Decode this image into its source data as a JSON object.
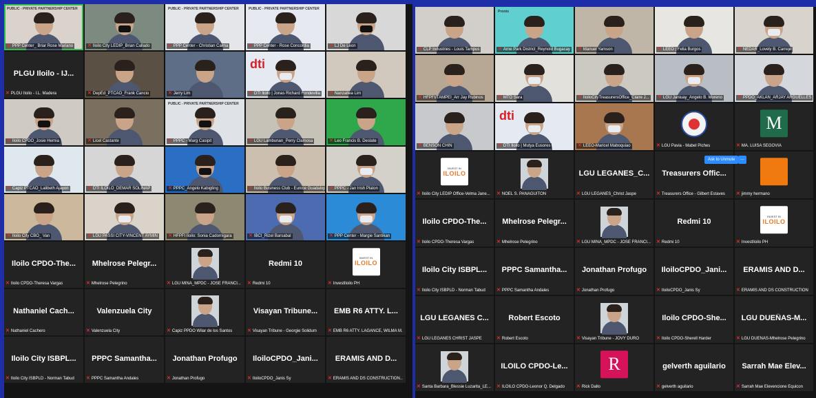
{
  "left_panel": {
    "tiles": [
      {
        "name": "PPP Center_ Briar Rose Mariano",
        "kind": "person",
        "bg": "#d9d3cc",
        "active": true,
        "logo": "PUBLIC - PRIVATE PARTNERSHIP CENTER"
      },
      {
        "name": "Iloilo City LEDIP_Brian Callado",
        "kind": "person",
        "bg": "#7d8a80",
        "mask": "dark"
      },
      {
        "name": "PPP Center - Christian Calma",
        "kind": "person",
        "bg": "#e4e6ea",
        "logo": "PUBLIC - PRIVATE PARTNERSHIP CENTER"
      },
      {
        "name": "PPP Center - Rose Concordia",
        "kind": "person",
        "bg": "#e6eaf0",
        "logo": "PUBLIC - PRIVATE PARTNERSHIP CENTER"
      },
      {
        "name": "LJ De Leon",
        "kind": "person",
        "bg": "#d8d8d8",
        "mask": "dark"
      },
      {
        "name": "PLGU Iloilo - IJ...",
        "label": "PLGU Iloilo - I.L. Madera",
        "kind": "text"
      },
      {
        "name": "DepEd_PTCAO_Frank Cancio",
        "kind": "person",
        "bg": "#5a5144"
      },
      {
        "name": "Jerry Lim",
        "kind": "person",
        "bg": "#5d6e86"
      },
      {
        "name": "DTI Iloilo | Jonas Richard Fondevilla",
        "kind": "person",
        "bg": "#e4e9f2",
        "logo": "dti",
        "mask": "light"
      },
      {
        "name": "Nanzaltea Lim",
        "kind": "person",
        "bg": "#d1c9bd"
      },
      {
        "name": "Iloilo CPDO_Josie Hernia",
        "kind": "person",
        "bg": "#cfcac4",
        "mask": "dark"
      },
      {
        "name": "Licel Castante",
        "kind": "person",
        "bg": "#7b705f"
      },
      {
        "name": "PPPC - Marg Casipit",
        "kind": "person",
        "bg": "#dfe2e6",
        "logo": "PUBLIC - PRIVATE PARTNERSHIP CENTER",
        "mask": "dark"
      },
      {
        "name": "LGU Lambunan_Perry Clamosa",
        "kind": "person",
        "bg": "#c7c2b8"
      },
      {
        "name": "Leo Francis B. Deslate",
        "kind": "person",
        "bg": "#2ea84a"
      },
      {
        "name": "Capiz PTCAO_Lalibeth Ajayon",
        "kind": "person",
        "bg": "#dfe8ee"
      },
      {
        "name": "DTI ILOILO_DEMAR SOLINAP",
        "kind": "person",
        "bg": "#d6d6d6"
      },
      {
        "name": "PPPC_Angelo Kabigting",
        "kind": "person",
        "bg": "#2a6fc4",
        "mask": "dark"
      },
      {
        "name": "Iloilo Business Club - Eunice Guadalope",
        "kind": "person",
        "bg": "#cdbfb0"
      },
      {
        "name": "PPPC - Jan Irish Platon",
        "kind": "person",
        "bg": "#d4d0ca",
        "mask": "light"
      },
      {
        "name": "Iloilo City CBO_ Van",
        "kind": "person",
        "bg": "#cbb89d"
      },
      {
        "name": "LGU PASSI CITY-VINCENT AYMIN",
        "kind": "person",
        "bg": "#d9d3c9",
        "mask": "light"
      },
      {
        "name": "HFPFI Iloilo: Sonia Cadornigara",
        "kind": "person",
        "bg": "#8d8872"
      },
      {
        "name": "IBCI_Rizel Barsabal",
        "kind": "person",
        "bg": "#4d6bb0",
        "mask": "light"
      },
      {
        "name": "PPP Center - Margie Santikan",
        "kind": "person",
        "bg": "#2b8bd6",
        "mask": "light"
      },
      {
        "name": "Iloilo CPDO-The...",
        "label": "Iloilo CPDO-Theresa Vargas",
        "kind": "text"
      },
      {
        "name": "Mhelrose Pelegr...",
        "label": "Mhelrose Pelegrino",
        "kind": "text"
      },
      {
        "name": "",
        "label": "LGU MINA_MPDC - JOSE FRANCI...",
        "kind": "photo"
      },
      {
        "name": "Redmi 10",
        "label": "Redmi 10",
        "kind": "text"
      },
      {
        "name": "",
        "label": "InvestIloilo PH",
        "kind": "iloilo"
      },
      {
        "name": "Nathaniel Cach...",
        "label": "Nathaniel Cachero",
        "kind": "text"
      },
      {
        "name": "Valenzuela City",
        "label": "Valenzuela City",
        "kind": "text"
      },
      {
        "name": "",
        "label": "Capiz PPDO Wilar de los Santos",
        "kind": "photo"
      },
      {
        "name": "Visayan Tribune...",
        "label": "Visayan Tribune - Georgie Solidum",
        "kind": "text"
      },
      {
        "name": "EMB R6 ATTY. L...",
        "label": "EMB R6 ATTY. LAGANCE, WILMA M...",
        "kind": "text"
      },
      {
        "name": "Iloilo City ISBPL...",
        "label": "Iloilo City ISBPLD - Norman Tabud",
        "kind": "text"
      },
      {
        "name": "PPPC Samantha...",
        "label": "PPPC Samantha Andales",
        "kind": "text"
      },
      {
        "name": "Jonathan Profugo",
        "label": "Jonathan Profugo",
        "kind": "text"
      },
      {
        "name": "IloiloCPDO_Jani...",
        "label": "IloiloCPDO_Janis Sy",
        "kind": "text"
      },
      {
        "name": "ERAMIS AND D...",
        "label": "ERAMIS AND DS CONSTRUCTION...",
        "kind": "text"
      }
    ]
  },
  "right_panel": {
    "tiles": [
      {
        "name": "CLP Industries - Louis Tampus",
        "kind": "person",
        "bg": "#d2cfca"
      },
      {
        "name": "Arne Park District_Reynold Bugacay",
        "kind": "person",
        "bg": "#5fcfcf",
        "logo": "Pronto"
      },
      {
        "name": "Manuel Yamson",
        "kind": "person",
        "bg": "#c0b6a8"
      },
      {
        "name": "LEEO | Felia Burgos",
        "kind": "person",
        "bg": "#e8e6e2"
      },
      {
        "name": "NEDAR_Lovely B. Carreje",
        "kind": "person",
        "bg": "#d8d3cc",
        "mask": "light"
      },
      {
        "name": "HFPFI/TAMPEI_Arr Jay Rubinos",
        "kind": "person",
        "bg": "#b7a795"
      },
      {
        "name": "MTO Sara",
        "kind": "person",
        "bg": "#e3e1dc",
        "mask": "light"
      },
      {
        "name": "IloiloCityTreasurersOffice_Claire J...",
        "kind": "person",
        "bg": "#ccc9c2"
      },
      {
        "name": "LGU Janiuay_Angelo B. Moreno",
        "kind": "person",
        "bg": "#b9bdc4",
        "mask": "light"
      },
      {
        "name": "PPDO_AKLAN_ARJAY ARGUELLES",
        "kind": "person",
        "bg": "#d4d8dc"
      },
      {
        "name": "BENSON CHIN",
        "kind": "person",
        "bg": "#c7c9cc"
      },
      {
        "name": "DTI Iloilo | Mutya Eusores",
        "kind": "person",
        "bg": "#e4e9f2",
        "logo": "dti",
        "mask": "light"
      },
      {
        "name": "LEEO-Maricel Maboquiao",
        "kind": "person",
        "bg": "#a8764f",
        "mask": "light"
      },
      {
        "name": "LGU Pavia - Mabel Piches",
        "label": "LGU Pavia - Mabel Piches",
        "kind": "seal"
      },
      {
        "name": "MA. LUISA SEGOVIA",
        "label": "MA. LUISA SEGOVIA",
        "kind": "letter",
        "letter": "M",
        "color": "#1f6b4a"
      },
      {
        "name": "",
        "label": "Iloilo City LEDIP Office-Velma Jane...",
        "kind": "iloilo"
      },
      {
        "name": "",
        "label": "NOEL S. PANAGUITON",
        "kind": "photo"
      },
      {
        "name": "LGU LEGANES_C...",
        "label": "LGU LEGANES_Christ Jaspe",
        "kind": "text"
      },
      {
        "name": "Treasurers Offic...",
        "label": "Treasurers Office - Gilbert Estaves",
        "kind": "text"
      },
      {
        "name": "",
        "label": "jimmy hermano",
        "kind": "letter",
        "letter": "",
        "color": "#f07a10"
      },
      {
        "name": "Iloilo CPDO-The...",
        "label": "Iloilo CPDO-Theresa Vargas",
        "kind": "text"
      },
      {
        "name": "Mhelrose Pelegr...",
        "label": "Mhelrose Pelegrino",
        "kind": "text"
      },
      {
        "name": "",
        "label": "LGU MINA_MPDC - JOSE FRANCI...",
        "kind": "photo"
      },
      {
        "name": "Redmi 10",
        "label": "Redmi 10",
        "kind": "text"
      },
      {
        "name": "",
        "label": "InvestIloilo PH",
        "kind": "iloilo"
      },
      {
        "name": "Iloilo City ISBPL...",
        "label": "Iloilo City ISBPLD - Norman Tabud",
        "kind": "text"
      },
      {
        "name": "PPPC Samantha...",
        "label": "PPPC Samantha Andales",
        "kind": "text"
      },
      {
        "name": "Jonathan Profugo",
        "label": "Jonathan Profugo",
        "kind": "text"
      },
      {
        "name": "IloiloCPDO_Jani...",
        "label": "IloiloCPDO_Janis Sy",
        "kind": "text"
      },
      {
        "name": "ERAMIS AND D...",
        "label": "ERAMIS AND DS CONSTRUCTION",
        "kind": "text"
      },
      {
        "name": "LGU LEGANES C...",
        "label": "LGU LEGANES CHRIST JASPE",
        "kind": "text"
      },
      {
        "name": "Robert Escoto",
        "label": "Robert Escoto",
        "kind": "text"
      },
      {
        "name": "",
        "label": "Visayan Tribune - JOVY DURO",
        "kind": "photo"
      },
      {
        "name": "Iloilo CPDO-She...",
        "label": "Iloilo CPDO-Sherell Harder",
        "kind": "text"
      },
      {
        "name": "LGU DUEÑAS-M...",
        "label": "LGU DUEÑAS-Mhelrose Pelegrino",
        "kind": "text"
      },
      {
        "name": "",
        "label": "Santa Barbara_Blessie Luzarita_LE...",
        "kind": "photo"
      },
      {
        "name": "ILOILO CPDO-Le...",
        "label": "ILOILO CPDO-Leonor Q. Delgado",
        "kind": "text"
      },
      {
        "name": "",
        "label": "Rick Dallo",
        "kind": "letter",
        "letter": "R",
        "color": "#d6135a"
      },
      {
        "name": "gelverth aguilario",
        "label": "gelverth aguilario",
        "kind": "text"
      },
      {
        "name": "Sarrah Mae Elev...",
        "label": "Sarrah Mae Elevencione Equicon",
        "kind": "text"
      }
    ],
    "ask_to_unmute": "Ask to Unmute",
    "more": "..."
  }
}
